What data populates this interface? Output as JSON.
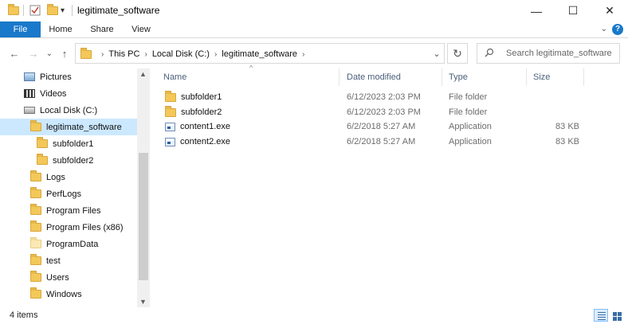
{
  "window": {
    "title": "legitimate_software",
    "minimize": "—",
    "maximize": "☐",
    "close": "✕"
  },
  "quick_access": {
    "dropdown_glyph": "▾"
  },
  "ribbon": {
    "tabs": [
      {
        "label": "File"
      },
      {
        "label": "Home"
      },
      {
        "label": "Share"
      },
      {
        "label": "View"
      }
    ],
    "expand_glyph": "⌄",
    "help": "?"
  },
  "nav": {
    "back": "←",
    "forward": "→",
    "recent": "⌄",
    "up": "↑",
    "breadcrumb": [
      "This PC",
      "Local Disk (C:)",
      "legitimate_software"
    ],
    "dropdown": "⌄",
    "refresh": "↻"
  },
  "search": {
    "icon": "search-icon",
    "placeholder": "Search legitimate_software"
  },
  "tree": {
    "items": [
      {
        "label": "Pictures",
        "icon": "pictures-icon"
      },
      {
        "label": "Videos",
        "icon": "videos-icon"
      },
      {
        "label": "Local Disk (C:)",
        "icon": "drive-icon"
      },
      {
        "label": "legitimate_software",
        "icon": "folder-icon",
        "selected": true
      },
      {
        "label": "subfolder1",
        "icon": "folder-icon"
      },
      {
        "label": "subfolder2",
        "icon": "folder-icon"
      },
      {
        "label": "Logs",
        "icon": "folder-icon"
      },
      {
        "label": "PerfLogs",
        "icon": "folder-icon"
      },
      {
        "label": "Program Files",
        "icon": "folder-icon"
      },
      {
        "label": "Program Files (x86)",
        "icon": "folder-icon"
      },
      {
        "label": "ProgramData",
        "icon": "folder-icon"
      },
      {
        "label": "test",
        "icon": "folder-icon"
      },
      {
        "label": "Users",
        "icon": "folder-icon"
      },
      {
        "label": "Windows",
        "icon": "folder-icon"
      }
    ],
    "scroll_up": "▲",
    "scroll_down": "▼"
  },
  "list": {
    "columns": [
      "Name",
      "Date modified",
      "Type",
      "Size"
    ],
    "sort_glyph": "^",
    "rows": [
      {
        "name": "subfolder1",
        "date": "6/12/2023 2:03 PM",
        "type": "File folder",
        "size": "",
        "icon": "folder-icon"
      },
      {
        "name": "subfolder2",
        "date": "6/12/2023 2:03 PM",
        "type": "File folder",
        "size": "",
        "icon": "folder-icon"
      },
      {
        "name": "content1.exe",
        "date": "6/2/2018 5:27 AM",
        "type": "Application",
        "size": "83 KB",
        "icon": "exe-icon"
      },
      {
        "name": "content2.exe",
        "date": "6/2/2018 5:27 AM",
        "type": "Application",
        "size": "83 KB",
        "icon": "exe-icon"
      }
    ]
  },
  "status": {
    "count": "4 items"
  },
  "colors": {
    "accent": "#1979ca",
    "selection": "#cce8ff",
    "folder": "#f3c859"
  }
}
